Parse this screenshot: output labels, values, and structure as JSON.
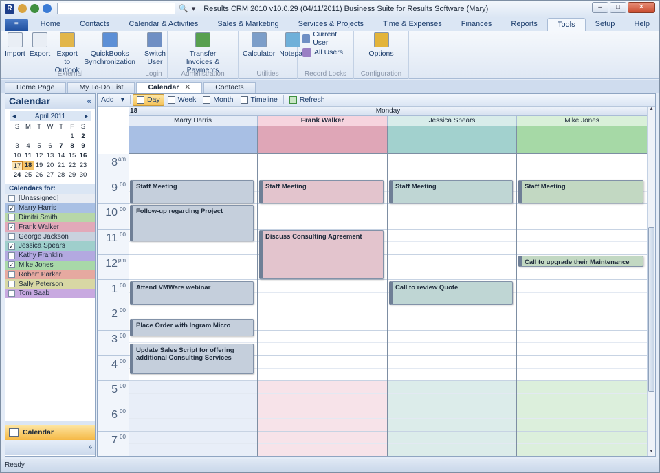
{
  "titlebar": {
    "app_icon": "R",
    "title": "Results CRM 2010 v10.0.29 (04/11/2011) Business Suite for Results Software (Mary)",
    "search_placeholder": "",
    "dropdown_arrow": "▾"
  },
  "menu": {
    "file_icon": "≡",
    "tabs": [
      "Home",
      "Contacts",
      "Calendar & Activities",
      "Sales & Marketing",
      "Services & Projects",
      "Time & Expenses",
      "Finances",
      "Reports",
      "Tools",
      "Setup",
      "Help"
    ],
    "active": "Tools"
  },
  "ribbon": {
    "groups": [
      {
        "label": "External",
        "buttons": [
          {
            "label": "Import",
            "icon": "import-icon"
          },
          {
            "label": "Export",
            "icon": "export-icon"
          },
          {
            "label": "Export to Outlook",
            "icon": "outlook-icon"
          },
          {
            "label": "QuickBooks Synchronization",
            "icon": "quickbooks-icon"
          }
        ]
      },
      {
        "label": "Login",
        "buttons": [
          {
            "label": "Switch User",
            "icon": "switch-user-icon"
          }
        ]
      },
      {
        "label": "Administration",
        "buttons": [
          {
            "label": "Transfer Invoices & Payments",
            "icon": "transfer-icon"
          }
        ]
      },
      {
        "label": "Utilities",
        "buttons": [
          {
            "label": "Calculator",
            "icon": "calculator-icon"
          },
          {
            "label": "Notepad",
            "icon": "notepad-icon"
          }
        ]
      },
      {
        "label": "Record Locks",
        "small": [
          {
            "label": "Current User",
            "icon": "current-user-icon"
          },
          {
            "label": "All Users",
            "icon": "all-users-icon"
          }
        ]
      },
      {
        "label": "Configuration",
        "buttons": [
          {
            "label": "Options",
            "icon": "options-icon"
          }
        ]
      }
    ]
  },
  "doctabs": [
    {
      "label": "Home Page",
      "active": false
    },
    {
      "label": "My To-Do List",
      "active": false
    },
    {
      "label": "Calendar",
      "active": true,
      "close": "✕"
    },
    {
      "label": "Contacts",
      "active": false
    }
  ],
  "sidebar": {
    "title": "Calendar",
    "collapse": "«",
    "minical": {
      "month": "April 2011",
      "prev": "◂",
      "next": "▸",
      "dow": [
        "S",
        "M",
        "T",
        "W",
        "T",
        "F",
        "S"
      ],
      "weeks": [
        [
          "",
          "",
          "",
          "",
          "",
          "1",
          "2"
        ],
        [
          "3",
          "4",
          "5",
          "6",
          "7",
          "8",
          "9"
        ],
        [
          "10",
          "11",
          "12",
          "13",
          "14",
          "15",
          "16"
        ],
        [
          "17",
          "18",
          "19",
          "20",
          "21",
          "22",
          "23"
        ],
        [
          "24",
          "25",
          "26",
          "27",
          "28",
          "29",
          "30"
        ]
      ],
      "bold_days": [
        "2",
        "7",
        "8",
        "9",
        "11",
        "16",
        "18",
        "24"
      ],
      "today": "17",
      "selected": "18"
    },
    "calendars_for_label": "Calendars for:",
    "calendars": [
      {
        "name": "[Unassigned]",
        "checked": false,
        "color": "#e8ecf3"
      },
      {
        "name": "Marry Harris",
        "checked": true,
        "color": "#a9c0e4"
      },
      {
        "name": "Dimitri Smith",
        "checked": false,
        "color": "#b7d7a8"
      },
      {
        "name": "Frank Walker",
        "checked": true,
        "color": "#e2a9b9"
      },
      {
        "name": "George Jackson",
        "checked": false,
        "color": "#c9d2de"
      },
      {
        "name": "Jessica Spears",
        "checked": true,
        "color": "#9fcfcc"
      },
      {
        "name": "Kathy Franklin",
        "checked": false,
        "color": "#b3a9e0"
      },
      {
        "name": "Mike Jones",
        "checked": true,
        "color": "#a8d8a8"
      },
      {
        "name": "Robert Parker",
        "checked": false,
        "color": "#e6a9a0"
      },
      {
        "name": "Sally Peterson",
        "checked": false,
        "color": "#d8d7a4"
      },
      {
        "name": "Tom Saab",
        "checked": false,
        "color": "#c8a9e0"
      }
    ],
    "nav_calendar": "Calendar",
    "nav_more": "»"
  },
  "toolbar": {
    "add": "Add",
    "add_arrow": "▾",
    "views": [
      {
        "label": "Day",
        "active": true
      },
      {
        "label": "Week",
        "active": false
      },
      {
        "label": "Month",
        "active": false
      },
      {
        "label": "Timeline",
        "active": false
      }
    ],
    "refresh": "Refresh"
  },
  "day": {
    "number": "18",
    "name": "Monday"
  },
  "resources": [
    {
      "name": "Marry Harris",
      "header_bg": "#e4ebf6",
      "allday_bg": "#a8bfe4",
      "work_bg": "#ffffff",
      "off_bg": "#e8eef8",
      "appt_bg": "#c5cfdc",
      "bold": false
    },
    {
      "name": "Frank Walker",
      "header_bg": "#f6d4de",
      "allday_bg": "#dfa6b7",
      "work_bg": "#ffffff",
      "off_bg": "#f7e3e9",
      "appt_bg": "#e3c4cd",
      "bold": true
    },
    {
      "name": "Jessica Spears",
      "header_bg": "#d8ecea",
      "allday_bg": "#a2d1ce",
      "work_bg": "#ffffff",
      "off_bg": "#dcecea",
      "appt_bg": "#bfd6d4",
      "bold": false
    },
    {
      "name": "Mike Jones",
      "header_bg": "#d9f0d9",
      "allday_bg": "#a6d9a6",
      "work_bg": "#ffffff",
      "off_bg": "#dcefdc",
      "appt_bg": "#c2d8c2",
      "bold": false
    }
  ],
  "hours": [
    {
      "h": "8",
      "m": "am"
    },
    {
      "h": "9",
      "m": "00"
    },
    {
      "h": "10",
      "m": "00"
    },
    {
      "h": "11",
      "m": "00"
    },
    {
      "h": "12",
      "m": "pm"
    },
    {
      "h": "1",
      "m": "00"
    },
    {
      "h": "2",
      "m": "00"
    },
    {
      "h": "3",
      "m": "00"
    },
    {
      "h": "4",
      "m": "00"
    },
    {
      "h": "5",
      "m": "00"
    },
    {
      "h": "6",
      "m": "00"
    },
    {
      "h": "7",
      "m": "00"
    }
  ],
  "appointments": [
    {
      "res": 0,
      "title": "Staff Meeting",
      "start": 9.0,
      "end": 10.0
    },
    {
      "res": 1,
      "title": "Staff Meeting",
      "start": 9.0,
      "end": 10.0
    },
    {
      "res": 2,
      "title": "Staff Meeting",
      "start": 9.0,
      "end": 10.0
    },
    {
      "res": 3,
      "title": "Staff Meeting",
      "start": 9.0,
      "end": 10.0
    },
    {
      "res": 0,
      "title": "Follow-up regarding Project",
      "start": 10.0,
      "end": 11.5
    },
    {
      "res": 1,
      "title": "Discuss Consulting Agreement",
      "start": 11.0,
      "end": 13.0
    },
    {
      "res": 3,
      "title": "Call to upgrade their Maintenance",
      "start": 12.0,
      "end": 12.5
    },
    {
      "res": 0,
      "title": "Attend VMWare webinar",
      "start": 13.0,
      "end": 14.0
    },
    {
      "res": 2,
      "title": "Call to review Quote",
      "start": 13.0,
      "end": 14.0
    },
    {
      "res": 0,
      "title": "Place Order with Ingram Micro",
      "start": 14.5,
      "end": 15.25
    },
    {
      "res": 0,
      "title": "Update Sales Script for offering additional Consulting Services",
      "start": 15.5,
      "end": 16.75
    }
  ],
  "status": "Ready"
}
